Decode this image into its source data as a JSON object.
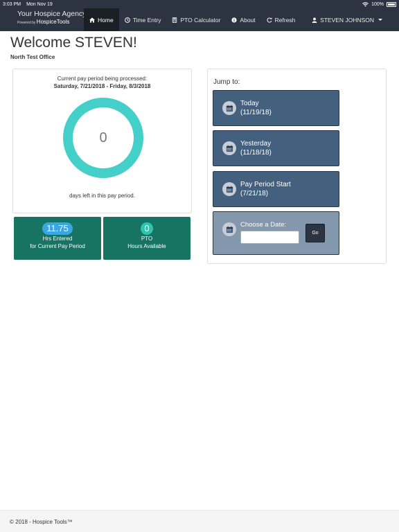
{
  "statusbar": {
    "time": "3:03 PM",
    "date": "Mon Nov 19",
    "battery": "100%"
  },
  "brand": {
    "name": "Your Hospice Agency",
    "powered_by": "Powered by",
    "product": "HospiceTools"
  },
  "nav": {
    "home": "Home",
    "time_entry": "Time Entry",
    "pto_calculator": "PTO Calculator",
    "about": "About",
    "refresh": "Refresh",
    "user": "STEVEN JOHNSON"
  },
  "welcome": "Welcome STEVEN!",
  "office": "North Test Office",
  "pay_period": {
    "label": "Current pay period being processed:",
    "dates": "Saturday, 7/21/2018 - Friday, 8/3/2018",
    "days_left_value": "0",
    "days_left_label": "days left in this pay period."
  },
  "tiles": {
    "hrs_value": "11.75",
    "hrs_line1": "Hrs Entered",
    "hrs_line2": "for Current Pay Period",
    "pto_value": "0",
    "pto_line1": "PTO",
    "pto_line2": "Hours Available"
  },
  "jump": {
    "title": "Jump to:",
    "today_label": "Today",
    "today_date": "(11/19/18)",
    "yesterday_label": "Yesterday",
    "yesterday_date": "(11/18/18)",
    "period_start_label": "Pay Period Start",
    "period_start_date": "(7/21/18)",
    "choose_label": "Choose a Date:",
    "choose_value": "",
    "go_label": "Go"
  },
  "footer": "© 2018 - Hospice Tools™",
  "colors": {
    "navbar": "#2b3440",
    "donut": "#45cfc9",
    "tile": "#177362",
    "jump_button": "#44607f",
    "badge": "#3aa7e0"
  },
  "icons": {
    "home": "home-icon",
    "clock": "clock-icon",
    "calculator": "calculator-icon",
    "info": "info-icon",
    "refresh": "refresh-icon",
    "user": "user-icon",
    "calendar": "calendar-icon"
  }
}
